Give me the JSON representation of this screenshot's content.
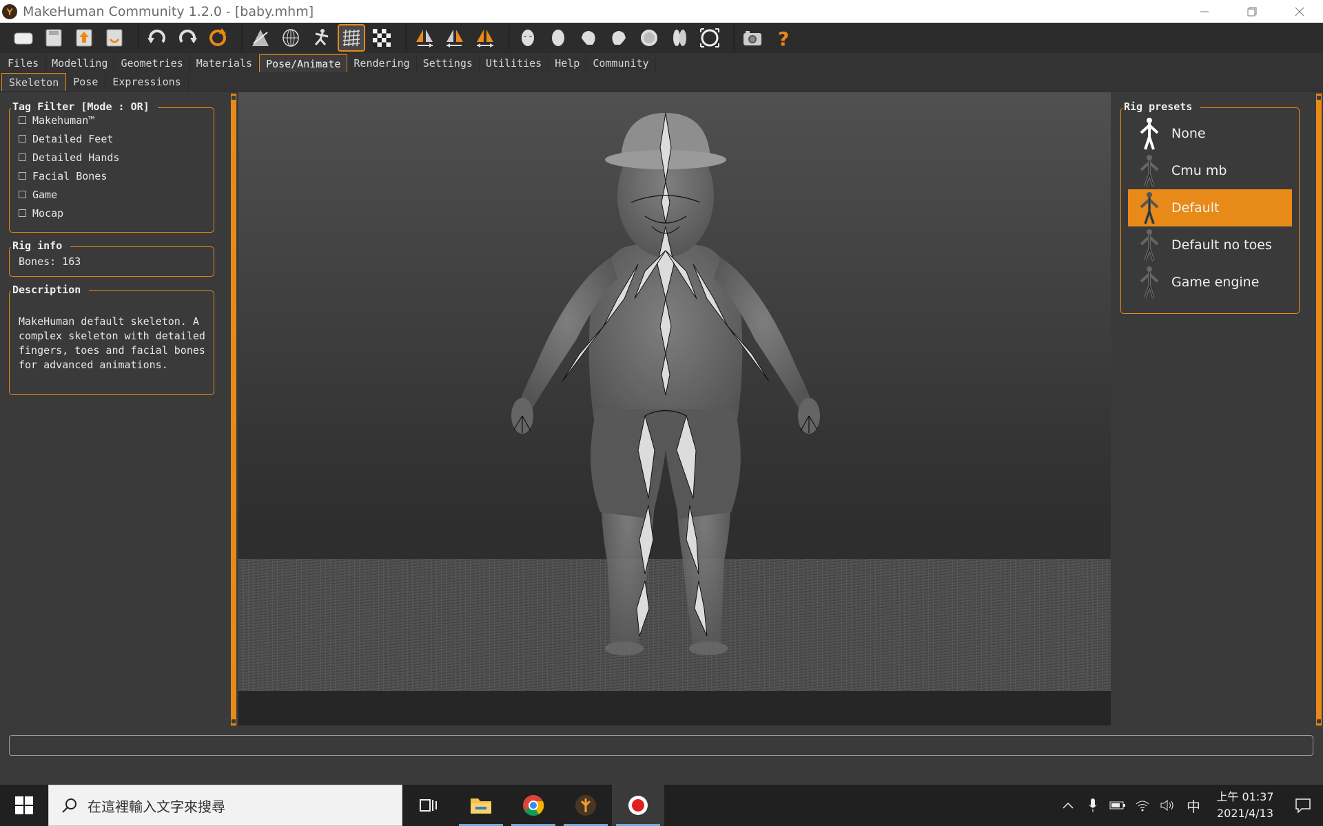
{
  "window": {
    "title": "MakeHuman Community 1.2.0 - [baby.mhm]",
    "app_icon": "makehuman-logo-icon",
    "controls": [
      "minimize-icon",
      "restore-icon",
      "close-icon"
    ]
  },
  "toolbar": {
    "groups": [
      [
        "load-icon",
        "save-icon",
        "export-icon",
        "save-as-icon"
      ],
      [
        "undo-icon",
        "redo-icon",
        "reset-icon"
      ],
      [
        "smooth-icon",
        "wireframe-icon",
        "pose-icon",
        "grid-icon",
        "checker-icon"
      ],
      [
        "symmetry-right-icon",
        "symmetry-left-icon",
        "symmetry-icon"
      ],
      [
        "front-view-icon",
        "back-view-icon",
        "left-view-icon",
        "right-view-icon",
        "top-view-icon",
        "bottom-view-icon",
        "reset-camera-icon"
      ],
      [
        "screenshot-icon",
        "help-icon"
      ]
    ],
    "accent": "#e88a17"
  },
  "tabs": [
    "Files",
    "Modelling",
    "Geometries",
    "Materials",
    "Pose/Animate",
    "Rendering",
    "Settings",
    "Utilities",
    "Help",
    "Community"
  ],
  "active_tab": "Pose/Animate",
  "subtabs": [
    "Skeleton",
    "Pose",
    "Expressions"
  ],
  "active_subtab": "Skeleton",
  "left": {
    "tag_filter": {
      "title": "Tag Filter [Mode : OR]",
      "items": [
        "Makehuman™",
        "Detailed Feet",
        "Detailed Hands",
        "Facial Bones",
        "Game",
        "Mocap"
      ]
    },
    "rig_info": {
      "title": "Rig info",
      "bones": "Bones: 163"
    },
    "description": {
      "title": "Description",
      "text_lines": [
        "MakeHuman default skeleton. A",
        "complex skeleton with detailed",
        "fingers, toes and facial bones",
        "for advanced animations."
      ]
    }
  },
  "right": {
    "rig_presets": {
      "title": "Rig presets",
      "items": [
        "None",
        "Cmu mb",
        "Default",
        "Default no toes",
        "Game engine"
      ],
      "selected": "Default"
    }
  },
  "taskbar": {
    "search_placeholder": "在這裡輸入文字來搜尋",
    "apps": [
      "task-view-icon",
      "file-explorer-icon",
      "chrome-icon",
      "makehuman-icon",
      "recorder-icon"
    ],
    "tray": [
      "chevron-up-icon",
      "microphone-icon",
      "battery-icon",
      "wifi-icon",
      "volume-icon"
    ],
    "ime": "中",
    "time": "上午 01:37",
    "date": "2021/4/13"
  }
}
